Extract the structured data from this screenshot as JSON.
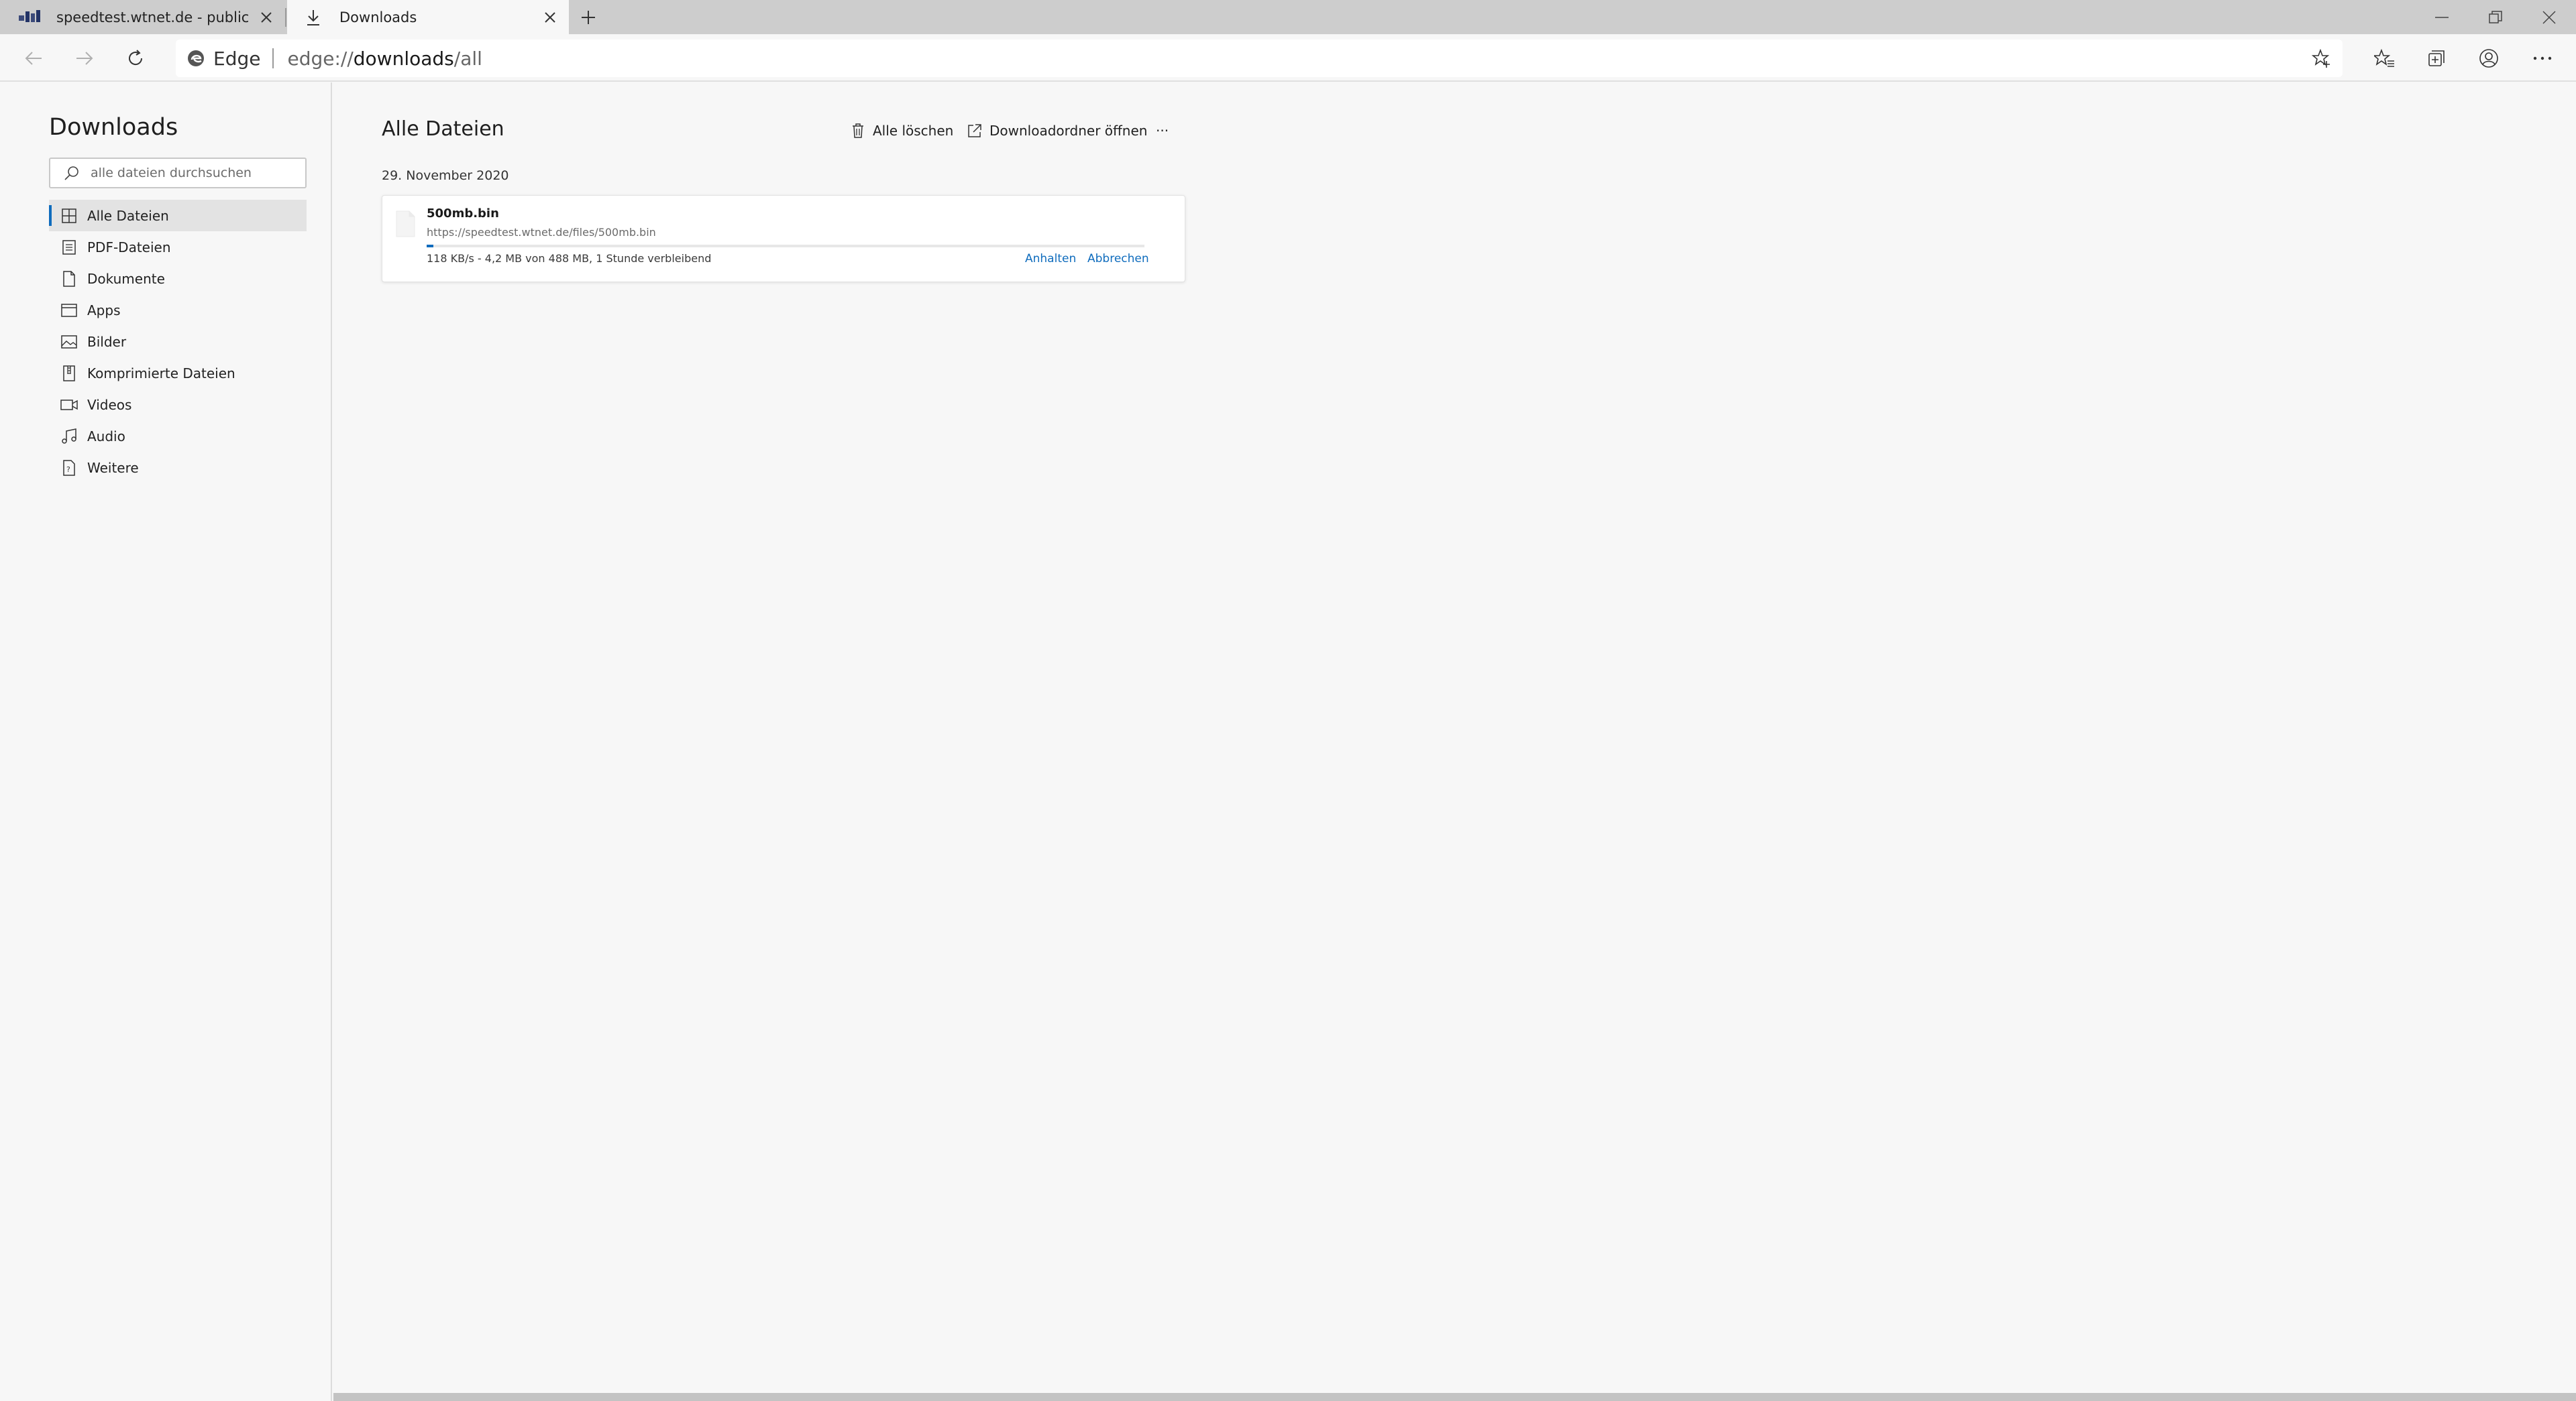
{
  "tabs": [
    {
      "title": "speedtest.wtnet.de - public iPerf"
    },
    {
      "title": "Downloads"
    }
  ],
  "address": {
    "brand": "Edge",
    "url_prefix": "edge://",
    "url_host": "downloads",
    "url_path": "/all"
  },
  "sidebar": {
    "title": "Downloads",
    "search_placeholder": "alle dateien durchsuchen",
    "items": [
      {
        "label": "Alle Dateien",
        "icon": "grid-icon"
      },
      {
        "label": "PDF-Dateien",
        "icon": "pdf-icon"
      },
      {
        "label": "Dokumente",
        "icon": "document-icon"
      },
      {
        "label": "Apps",
        "icon": "app-icon"
      },
      {
        "label": "Bilder",
        "icon": "image-icon"
      },
      {
        "label": "Komprimierte Dateien",
        "icon": "zip-icon"
      },
      {
        "label": "Videos",
        "icon": "video-icon"
      },
      {
        "label": "Audio",
        "icon": "audio-icon"
      },
      {
        "label": "Weitere",
        "icon": "other-file-icon"
      }
    ]
  },
  "main": {
    "title": "Alle Dateien",
    "clear_all": "Alle löschen",
    "open_folder": "Downloadordner öffnen",
    "more": "···",
    "date": "29. November 2020",
    "download": {
      "filename": "500mb.bin",
      "url": "https://speedtest.wtnet.de/files/500mb.bin",
      "status": "118 KB/s - 4,2 MB von 488 MB, 1 Stunde verbleibend",
      "progress_percent": 0.9,
      "pause": "Anhalten",
      "cancel": "Abbrechen"
    }
  },
  "colors": {
    "accent": "#0f6cbd",
    "tabstrip": "#cdcdcd",
    "background": "#f7f7f7"
  }
}
